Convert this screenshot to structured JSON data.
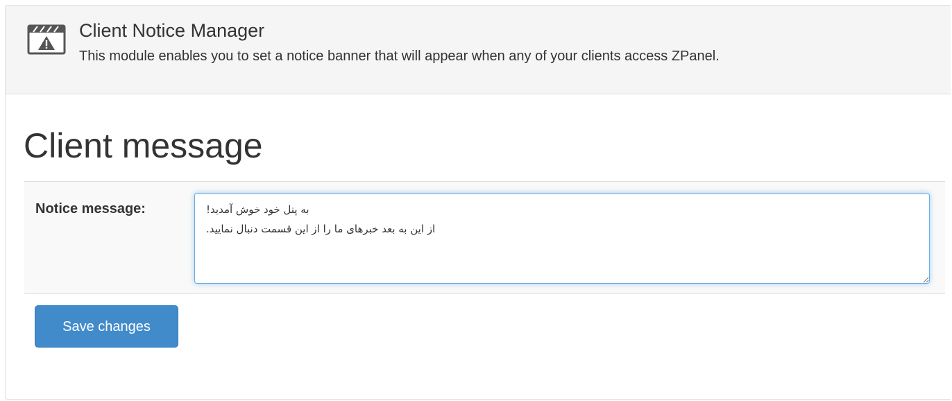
{
  "module": {
    "title": "Client Notice Manager",
    "description": "This module enables you to set a notice banner that will appear when any of your clients access ZPanel.",
    "icon": "warning-notice-board-icon"
  },
  "section": {
    "title": "Client message"
  },
  "form": {
    "notice_label": "Notice message:",
    "notice_value": "!به پنل خود خوش آمدید\n.از این به بعد خبرهای ما را از این قسمت دنبال نمایید",
    "save_label": "Save changes"
  },
  "colors": {
    "header_bg": "#f5f5f5",
    "row_bg": "#f9f9f9",
    "button_bg": "#428bca",
    "focus_border": "#66afe9"
  }
}
